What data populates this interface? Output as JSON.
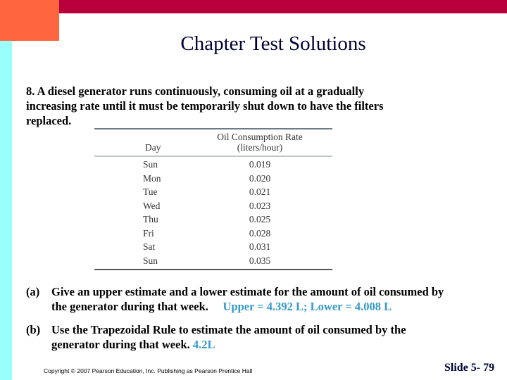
{
  "slide": {
    "title": "Chapter Test Solutions",
    "question": "8.  A diesel generator runs continuously, consuming oil at a gradually increasing rate until it must be temporarily shut down to have the filters replaced.",
    "table": {
      "header_day": "Day",
      "header_rate_line1": "Oil Consumption Rate",
      "header_rate_line2": "(liters/hour)",
      "rows": [
        {
          "day": "Sun",
          "rate": "0.019"
        },
        {
          "day": "Mon",
          "rate": "0.020"
        },
        {
          "day": "Tue",
          "rate": "0.021"
        },
        {
          "day": "Wed",
          "rate": "0.023"
        },
        {
          "day": "Thu",
          "rate": "0.025"
        },
        {
          "day": "Fri",
          "rate": "0.028"
        },
        {
          "day": "Sat",
          "rate": "0.031"
        },
        {
          "day": "Sun",
          "rate": "0.035"
        }
      ]
    },
    "part_a": {
      "label": "(a)",
      "line1": "Give an upper estimate and a lower estimate for the amount of oil consumed by",
      "line2": "the generator during that week.",
      "answer": "Upper = 4.392 L; Lower = 4.008 L"
    },
    "part_b": {
      "label": "(b)",
      "line1": "Use the Trapezoidal Rule to estimate the amount of oil consumed by the",
      "line2": "generator during that week.",
      "answer": "4.2L"
    },
    "copyright": "Copyright © 2007 Pearson Education, Inc. Publishing as Pearson Prentice Hall",
    "slide_number": "Slide 5-  79"
  },
  "colors": {
    "top_bar": "#b8003c",
    "corner_block": "#ff6640",
    "side_bar": "#99ffff",
    "answer": "#3399cc",
    "title": "#000033"
  }
}
